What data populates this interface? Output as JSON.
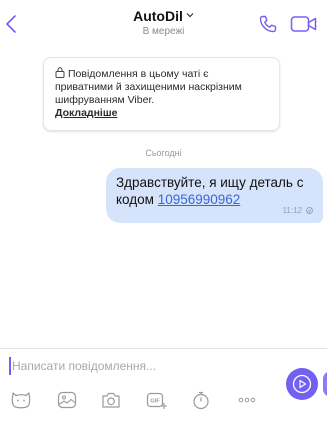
{
  "header": {
    "title": "AutoDil",
    "subtitle": "В мережі"
  },
  "notice": {
    "text": "Повідомлення в цьому чаті є приватними й захищеними наскрізним шифруванням Viber.",
    "link": "Докладніше"
  },
  "date_separator": "Сьогодні",
  "messages": [
    {
      "text_before": "Здравствуйте, я ищу деталь с кодом ",
      "phone": "10956990962",
      "time": "11:12"
    }
  ],
  "composer": {
    "placeholder": "Написати повідомлення..."
  },
  "colors": {
    "accent": "#7360f2",
    "bubble": "#d6e4fb",
    "link": "#3767d6"
  },
  "icons": {
    "back": "chevron-left-icon",
    "call": "phone-icon",
    "video": "video-icon",
    "lock": "lock-icon",
    "sticker": "sticker-icon",
    "gallery": "gallery-icon",
    "camera": "camera-icon",
    "gif": "gif-icon",
    "timer": "timer-icon",
    "more": "more-icon",
    "send": "send-icon"
  }
}
